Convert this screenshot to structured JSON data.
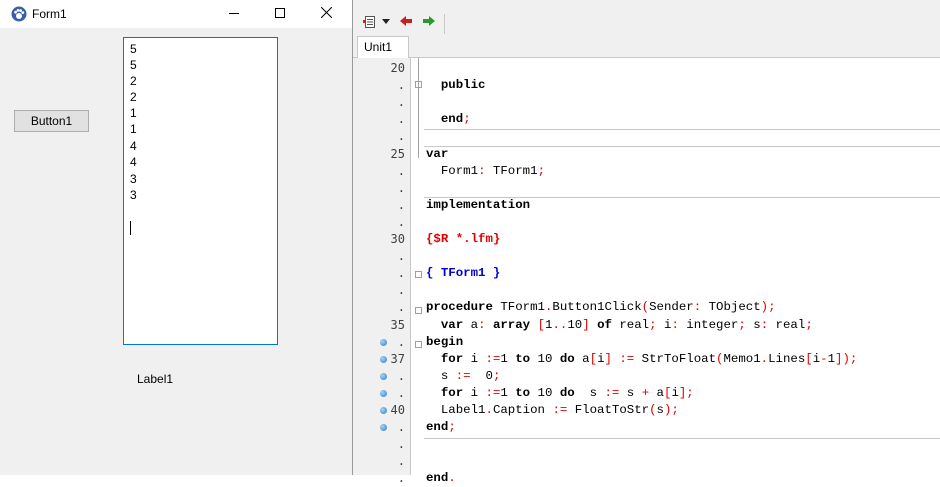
{
  "form": {
    "title": "Form1",
    "button_label": "Button1",
    "memo_lines": [
      "5",
      "5",
      "2",
      "2",
      "1",
      "1",
      "4",
      "4",
      "3",
      "3"
    ],
    "label": "Label1"
  },
  "editor": {
    "tab": "Unit1",
    "gutter": [
      {
        "n": "20",
        "bp": false
      },
      {
        "n": ".",
        "bp": false
      },
      {
        "n": ".",
        "bp": false
      },
      {
        "n": ".",
        "bp": false
      },
      {
        "n": ".",
        "bp": false
      },
      {
        "n": "25",
        "bp": false
      },
      {
        "n": ".",
        "bp": false
      },
      {
        "n": ".",
        "bp": false
      },
      {
        "n": ".",
        "bp": false
      },
      {
        "n": ".",
        "bp": false
      },
      {
        "n": "30",
        "bp": false
      },
      {
        "n": ".",
        "bp": false
      },
      {
        "n": ".",
        "bp": false
      },
      {
        "n": ".",
        "bp": false
      },
      {
        "n": ".",
        "bp": false
      },
      {
        "n": "35",
        "bp": false
      },
      {
        "n": ".",
        "bp": true
      },
      {
        "n": "37",
        "bp": true
      },
      {
        "n": ".",
        "bp": true
      },
      {
        "n": ".",
        "bp": true
      },
      {
        "n": "40",
        "bp": true
      },
      {
        "n": ".",
        "bp": true
      },
      {
        "n": ".",
        "bp": false
      },
      {
        "n": ".",
        "bp": false
      },
      {
        "n": ".",
        "bp": false
      }
    ],
    "code_lines": [
      [],
      [
        [
          "  ",
          ""
        ],
        [
          "public",
          "kw"
        ]
      ],
      [],
      [
        [
          "  ",
          ""
        ],
        [
          "end",
          "kw"
        ],
        [
          ";",
          "sym"
        ]
      ],
      [],
      [
        [
          "var",
          "kw"
        ]
      ],
      [
        [
          "  Form1",
          ""
        ],
        [
          ":",
          "sym"
        ],
        [
          " TForm1",
          ""
        ],
        [
          ";",
          "sym"
        ]
      ],
      [],
      [
        [
          "implementation",
          "kw"
        ]
      ],
      [],
      [
        [
          "{$R *.lfm}",
          "dir"
        ]
      ],
      [],
      [
        [
          "{ TForm1 }",
          "cmt"
        ]
      ],
      [],
      [
        [
          "procedure",
          "kw"
        ],
        [
          " TForm1",
          ""
        ],
        [
          ".",
          "sym"
        ],
        [
          "Button1Click",
          ""
        ],
        [
          "(",
          "sym"
        ],
        [
          "Sender",
          ""
        ],
        [
          ":",
          "sym"
        ],
        [
          " TObject",
          ""
        ],
        [
          ");",
          "sym"
        ]
      ],
      [
        [
          "  ",
          ""
        ],
        [
          "var",
          "kw"
        ],
        [
          " a",
          ""
        ],
        [
          ":",
          "sym"
        ],
        [
          " ",
          ""
        ],
        [
          "array",
          "kw"
        ],
        [
          " ",
          ""
        ],
        [
          "[",
          "sym"
        ],
        [
          "1",
          ""
        ],
        [
          "..",
          "sym"
        ],
        [
          "10",
          ""
        ],
        [
          "]",
          "sym"
        ],
        [
          " ",
          ""
        ],
        [
          "of",
          "kw"
        ],
        [
          " real",
          ""
        ],
        [
          ";",
          "sym"
        ],
        [
          " i",
          ""
        ],
        [
          ":",
          "sym"
        ],
        [
          " integer",
          ""
        ],
        [
          ";",
          "sym"
        ],
        [
          " s",
          ""
        ],
        [
          ":",
          "sym"
        ],
        [
          " real",
          ""
        ],
        [
          ";",
          "sym"
        ]
      ],
      [
        [
          "begin",
          "kw"
        ]
      ],
      [
        [
          "  ",
          ""
        ],
        [
          "for",
          "kw"
        ],
        [
          " i ",
          ""
        ],
        [
          ":=",
          "sym"
        ],
        [
          "1 ",
          ""
        ],
        [
          "to",
          "kw"
        ],
        [
          " 10 ",
          ""
        ],
        [
          "do",
          "kw"
        ],
        [
          " a",
          ""
        ],
        [
          "[",
          "sym"
        ],
        [
          "i",
          ""
        ],
        [
          "]",
          "sym"
        ],
        [
          " ",
          ""
        ],
        [
          ":=",
          "sym"
        ],
        [
          " StrToFloat",
          ""
        ],
        [
          "(",
          "sym"
        ],
        [
          "Memo1",
          ""
        ],
        [
          ".",
          "sym"
        ],
        [
          "Lines",
          ""
        ],
        [
          "[",
          "sym"
        ],
        [
          "i",
          ""
        ],
        [
          "-",
          "sym"
        ],
        [
          "1",
          ""
        ],
        [
          "]);",
          "sym"
        ]
      ],
      [
        [
          "  s ",
          ""
        ],
        [
          ":=",
          "sym"
        ],
        [
          "  0",
          ""
        ],
        [
          ";",
          "sym"
        ]
      ],
      [
        [
          "  ",
          ""
        ],
        [
          "for",
          "kw"
        ],
        [
          " i ",
          ""
        ],
        [
          ":=",
          "sym"
        ],
        [
          "1 ",
          ""
        ],
        [
          "to",
          "kw"
        ],
        [
          " 10 ",
          ""
        ],
        [
          "do",
          "kw"
        ],
        [
          "  s ",
          ""
        ],
        [
          ":=",
          "sym"
        ],
        [
          " s ",
          ""
        ],
        [
          "+",
          "sym"
        ],
        [
          " a",
          ""
        ],
        [
          "[",
          "sym"
        ],
        [
          "i",
          ""
        ],
        [
          "];",
          "sym"
        ]
      ],
      [
        [
          "  Label1",
          ""
        ],
        [
          ".",
          "sym"
        ],
        [
          "Caption ",
          ""
        ],
        [
          ":=",
          "sym"
        ],
        [
          " FloatToStr",
          ""
        ],
        [
          "(",
          "sym"
        ],
        [
          "s",
          ""
        ],
        [
          ");",
          "sym"
        ]
      ],
      [
        [
          "end",
          "kw"
        ],
        [
          ";",
          "sym"
        ]
      ],
      [],
      [],
      [
        [
          "end",
          "kw"
        ],
        [
          ".",
          "sym"
        ]
      ]
    ]
  },
  "icons": {
    "app": "lazarus-paw-icon",
    "minimize": "minimize-icon",
    "maximize": "maximize-icon",
    "close": "close-icon",
    "toolbar": [
      "unit-list-icon",
      "dropdown-arrow-icon",
      "jump-back-icon",
      "jump-forward-icon"
    ]
  },
  "colors": {
    "keyword": "#000000",
    "symbol": "#e00000",
    "directive": "#e00000",
    "comment": "#0000d0",
    "memo_border": "#0078d7"
  }
}
